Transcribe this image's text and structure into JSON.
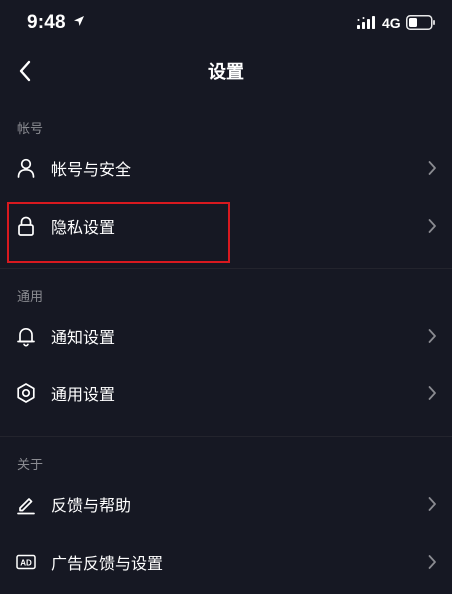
{
  "status_bar": {
    "time": "9:48",
    "network": "4G",
    "icons": [
      "location-arrow-icon",
      "signal-icon",
      "battery-icon"
    ]
  },
  "nav": {
    "title": "设置",
    "back_icon": "chevron-left-icon"
  },
  "sections": {
    "account": {
      "header": "帐号",
      "items": [
        {
          "label": "帐号与安全",
          "icon": "user-icon"
        },
        {
          "label": "隐私设置",
          "icon": "lock-icon"
        }
      ]
    },
    "general": {
      "header": "通用",
      "items": [
        {
          "label": "通知设置",
          "icon": "bell-icon"
        },
        {
          "label": "通用设置",
          "icon": "gear-icon"
        }
      ]
    },
    "about": {
      "header": "关于",
      "items": [
        {
          "label": "反馈与帮助",
          "icon": "edit-icon"
        },
        {
          "label": "广告反馈与设置",
          "icon": "ad-icon"
        }
      ]
    }
  },
  "colors": {
    "background": "#161823",
    "text": "#ffffff",
    "section_header": "#8a8b91",
    "chevron": "#8a8b91",
    "highlight": "#d8191f"
  }
}
